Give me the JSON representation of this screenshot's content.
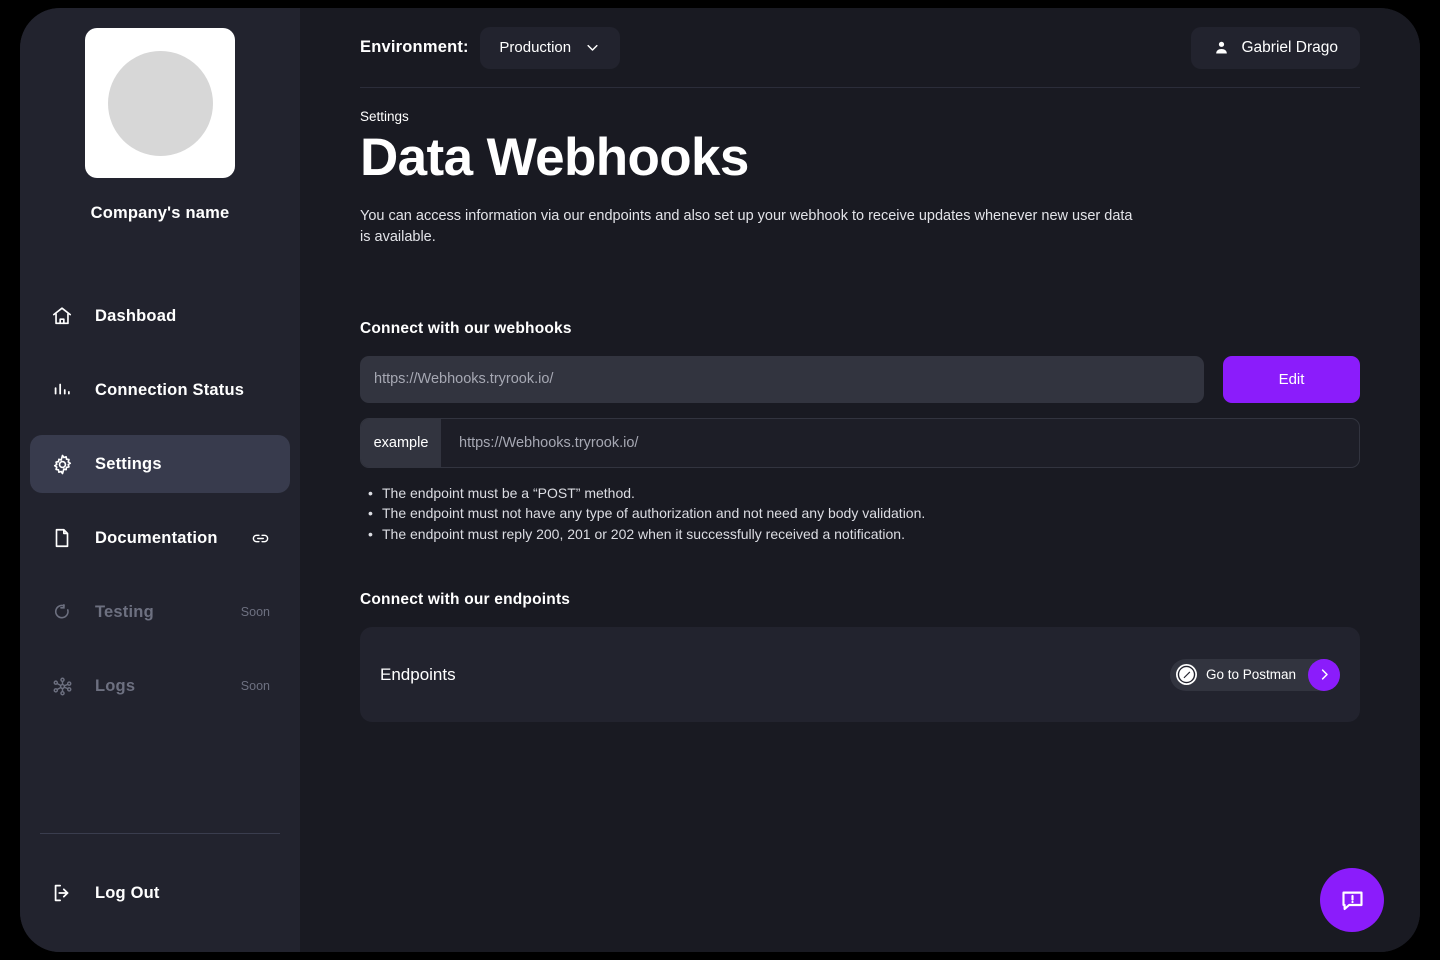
{
  "sidebar": {
    "brand": {
      "logo_icon": "company-logo-placeholder",
      "name": "Company's name"
    },
    "items": [
      {
        "label": "Dashboad",
        "icon": "home-icon",
        "state": "default",
        "trailing": ""
      },
      {
        "label": "Connection Status",
        "icon": "bar-chart-icon",
        "state": "default",
        "trailing": ""
      },
      {
        "label": "Settings",
        "icon": "gear-icon",
        "state": "active",
        "trailing": ""
      },
      {
        "label": "Documentation",
        "icon": "document-icon",
        "state": "default",
        "trailing": "link-icon"
      },
      {
        "label": "Testing",
        "icon": "refresh-icon",
        "state": "disabled",
        "trailing": "Soon"
      },
      {
        "label": "Logs",
        "icon": "nodes-icon",
        "state": "disabled",
        "trailing": "Soon"
      }
    ],
    "logout": {
      "label": "Log Out",
      "icon": "logout-icon"
    }
  },
  "topbar": {
    "environment_label": "Environment:",
    "environment_value": "Production",
    "environment_chevron_icon": "chevron-down-icon",
    "user_name": "Gabriel Drago",
    "user_icon": "person-icon"
  },
  "header": {
    "eyebrow": "Settings",
    "title": "Data Webhooks",
    "description": "You can access information via our endpoints and also set up your webhook to receive updates whenever new user data is available."
  },
  "webhooks": {
    "heading": "Connect with our webhooks",
    "url_value": "",
    "url_placeholder": "https://Webhooks.tryrook.io/",
    "edit_label": "Edit",
    "example_tag": "example",
    "example_value": "https://Webhooks.tryrook.io/",
    "rules": [
      "The endpoint must be a “POST” method.",
      "The endpoint must not have any type of authorization and not need any body validation.",
      "The endpoint must reply 200, 201 or 202 when it successfully received a notification."
    ]
  },
  "endpoints": {
    "heading": "Connect with our endpoints",
    "card_title": "Endpoints",
    "postman_label": "Go to Postman",
    "postman_icon": "postman-icon",
    "postman_arrow_icon": "chevron-right-icon"
  },
  "fab": {
    "icon": "chat-alert-icon"
  },
  "colors": {
    "accent": "#8b1cfb",
    "sidebar_bg": "#22232e",
    "main_bg": "#191a22",
    "active_item_bg": "#383b4d",
    "input_bg": "#32343f",
    "muted_text": "#6d7080"
  }
}
